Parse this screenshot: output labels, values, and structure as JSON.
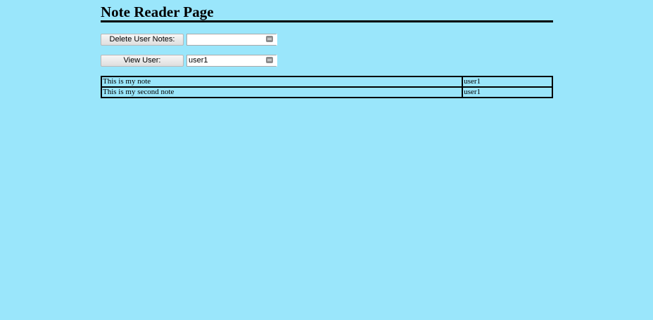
{
  "page": {
    "title": "Note Reader Page"
  },
  "delete_form": {
    "button_label": "Delete User Notes:",
    "field_value": ""
  },
  "view_form": {
    "button_label": "View User:",
    "field_value": "user1"
  },
  "notes": [
    {
      "text": "This is my note",
      "user": "user1"
    },
    {
      "text": "This is my second note",
      "user": "user1"
    }
  ],
  "colors": {
    "background": "#9ae6fb",
    "rule": "#000000"
  }
}
